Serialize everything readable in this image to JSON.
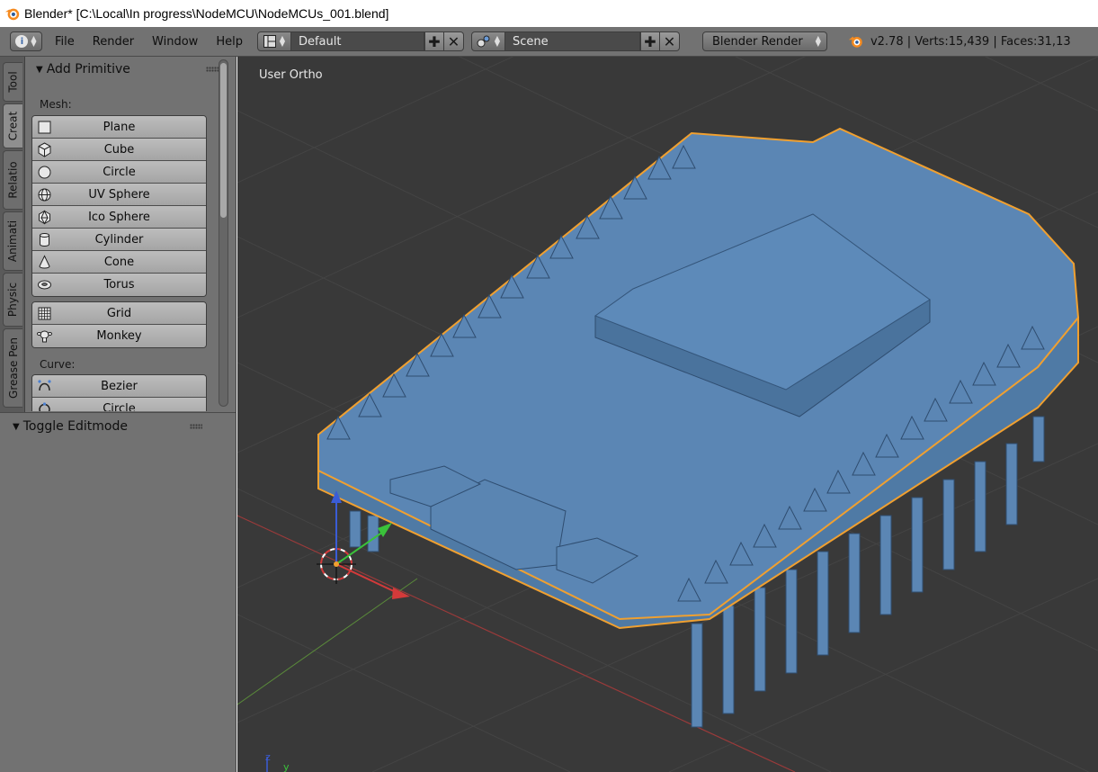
{
  "window": {
    "title": "Blender* [C:\\Local\\In progress\\NodeMCU\\NodeMCUs_001.blend]"
  },
  "infobar": {
    "menus": [
      "File",
      "Render",
      "Window",
      "Help"
    ],
    "layout": "Default",
    "scene": "Scene",
    "render_engine": "Blender Render",
    "stats": "v2.78 | Verts:15,439 | Faces:31,13"
  },
  "tabs": [
    "Tool",
    "Creat",
    "Relatio",
    "Animati",
    "Physic",
    "Grease Pen"
  ],
  "tool_shelf": {
    "panel_title": "Add Primitive",
    "mesh_label": "Mesh:",
    "mesh_group1": [
      "Plane",
      "Cube",
      "Circle",
      "UV Sphere",
      "Ico Sphere",
      "Cylinder",
      "Cone",
      "Torus"
    ],
    "mesh_group2": [
      "Grid",
      "Monkey"
    ],
    "curve_label": "Curve:",
    "curve_items": [
      "Bezier",
      "Circle"
    ]
  },
  "operator_panel": {
    "title": "Toggle Editmode"
  },
  "viewport": {
    "view_label": "User Ortho",
    "axis_z_label": "z",
    "axis_y_label": "y"
  },
  "colors": {
    "mesh_fill": "#5b86b4",
    "selection_outline": "#f0a030",
    "viewport_bg": "#393939",
    "panel_bg": "#727272"
  }
}
